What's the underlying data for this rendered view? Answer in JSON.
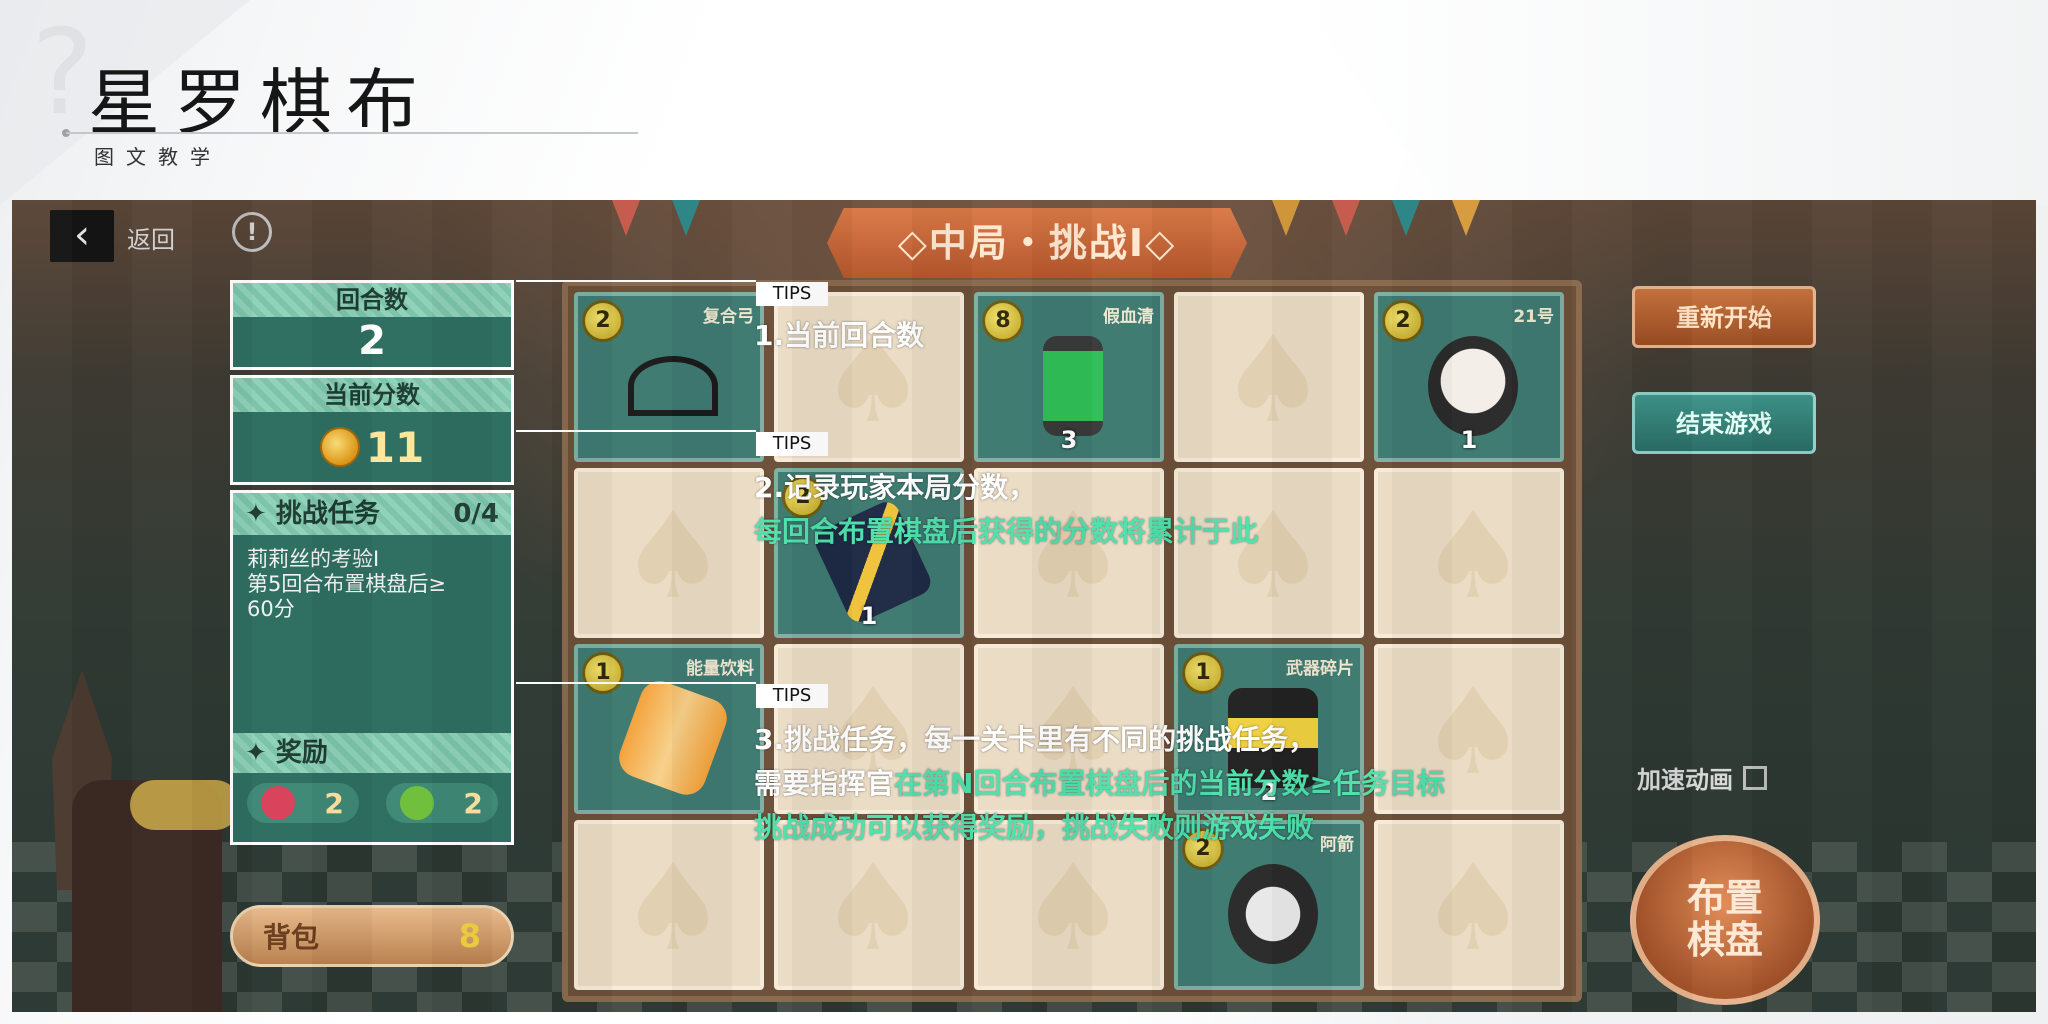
{
  "slide": {
    "title": "星罗棋布",
    "subtitle": "图文教学"
  },
  "game": {
    "back_label": "返回",
    "stage_banner": "◇中局・挑战Ⅰ◇",
    "round": {
      "label": "回合数",
      "value": "2"
    },
    "score": {
      "label": "当前分数",
      "value": "11"
    },
    "task": {
      "label": "挑战任务",
      "progress": "0/4",
      "description": "莉莉丝的考验Ⅰ\n第5回合布置棋盘后≥\n60分",
      "reward_label": "奖励",
      "rewards": [
        {
          "value": "2",
          "color": "#d9405a"
        },
        {
          "value": "2",
          "color": "#6fbf3a"
        }
      ]
    },
    "bag": {
      "label": "背包",
      "count": "8"
    },
    "buttons": {
      "restart": "重新开始",
      "end": "结束游戏",
      "speed": "加速动画",
      "place": "布置\n棋盘"
    },
    "board_cells": [
      {
        "name": "复合弓",
        "badge": "2",
        "count": "",
        "filled": true,
        "art": "bow"
      },
      {
        "name": "",
        "badge": "",
        "count": "",
        "filled": false
      },
      {
        "name": "假血清",
        "badge": "8",
        "count": "3",
        "filled": true,
        "art": "serum"
      },
      {
        "name": "",
        "badge": "",
        "count": "",
        "filled": false
      },
      {
        "name": "21号",
        "badge": "2",
        "count": "1",
        "filled": true,
        "art": "girl"
      },
      {
        "name": "",
        "badge": "",
        "count": "",
        "filled": false
      },
      {
        "name": "",
        "badge": "2",
        "count": "1",
        "filled": true,
        "art": "card"
      },
      {
        "name": "",
        "badge": "",
        "count": "",
        "filled": false
      },
      {
        "name": "",
        "badge": "",
        "count": "",
        "filled": false
      },
      {
        "name": "",
        "badge": "",
        "count": "",
        "filled": false
      },
      {
        "name": "能量饮料",
        "badge": "1",
        "count": "",
        "filled": true,
        "art": "can"
      },
      {
        "name": "",
        "badge": "",
        "count": "",
        "filled": false
      },
      {
        "name": "",
        "badge": "",
        "count": "",
        "filled": false
      },
      {
        "name": "武器碎片",
        "badge": "1",
        "count": "2",
        "filled": true,
        "art": "chip"
      },
      {
        "name": "",
        "badge": "",
        "count": "",
        "filled": false
      },
      {
        "name": "",
        "badge": "",
        "count": "",
        "filled": false
      },
      {
        "name": "",
        "badge": "",
        "count": "",
        "filled": false
      },
      {
        "name": "",
        "badge": "",
        "count": "",
        "filled": false
      },
      {
        "name": "阿箭",
        "badge": "2",
        "count": "",
        "filled": true,
        "art": "mask"
      },
      {
        "name": "",
        "badge": "",
        "count": "",
        "filled": false
      }
    ]
  },
  "annotations": {
    "tips_label": "TIPS",
    "tip1": "1.当前回合数",
    "tip2_line1": "2.记录玩家本局分数，",
    "tip2_line2": "每回合布置棋盘后获得的分数将累计于此",
    "tip3_line1": "3.挑战任务，每一关卡里有不同的挑战任务，",
    "tip3_line2_prefix": "需要指挥官",
    "tip3_line2_hl": "在第N回合布置棋盘后的当前分数≥任务目标",
    "tip3_line3": "挑战成功可以获得奖励，挑战失败则游戏失败"
  },
  "colors": {
    "highlight": "#4fe0ac",
    "panel": "#2d6e60",
    "board": "#6d4f39"
  }
}
